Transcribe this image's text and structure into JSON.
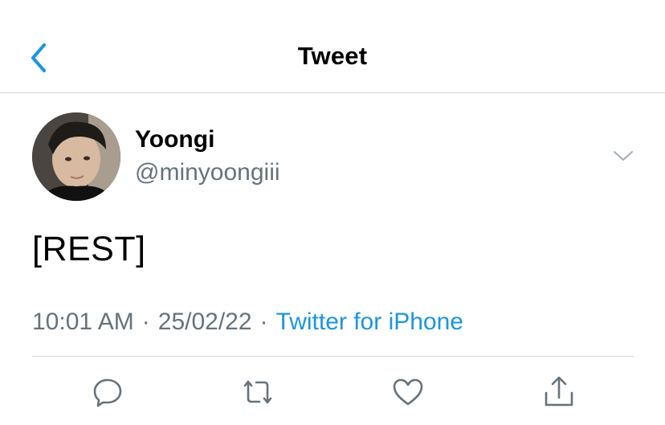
{
  "header": {
    "title": "Tweet",
    "back_icon": "chevron-left-icon"
  },
  "author": {
    "display_name": "Yoongi",
    "handle": "@minyoongiii",
    "avatar": "profile-photo"
  },
  "tweet": {
    "text": "[REST]",
    "time": "10:01 AM",
    "separator": "·",
    "date": "25/02/22",
    "source": "Twitter for iPhone"
  },
  "actions": [
    "reply-icon",
    "retweet-icon",
    "like-icon",
    "share-icon"
  ],
  "colors": {
    "accent": "#1b95e0",
    "secondary_text": "#66727c",
    "icon": "#66727c",
    "divider": "#d6dbdf"
  }
}
